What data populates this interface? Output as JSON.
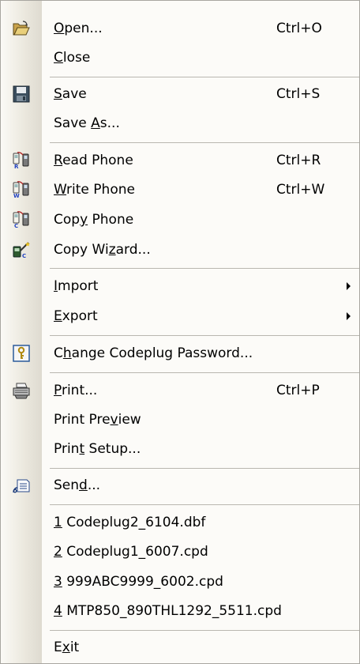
{
  "menu": {
    "open": {
      "pre": "",
      "ul": "O",
      "post": "pen...",
      "shortcut": "Ctrl+O"
    },
    "close": {
      "pre": "",
      "ul": "C",
      "post": "lose"
    },
    "save": {
      "pre": "",
      "ul": "S",
      "post": "ave",
      "shortcut": "Ctrl+S"
    },
    "save_as": {
      "pre": "Save ",
      "ul": "A",
      "post": "s..."
    },
    "read_phone": {
      "pre": "",
      "ul": "R",
      "post": "ead Phone",
      "shortcut": "Ctrl+R"
    },
    "write_phone": {
      "pre": "",
      "ul": "W",
      "post": "rite Phone",
      "shortcut": "Ctrl+W"
    },
    "copy_phone": {
      "pre": "Cop",
      "ul": "y",
      "post": " Phone"
    },
    "copy_wizard": {
      "pre": "Copy Wi",
      "ul": "z",
      "post": "ard..."
    },
    "import": {
      "pre": "",
      "ul": "I",
      "post": "mport"
    },
    "export": {
      "pre": "",
      "ul": "E",
      "post": "xport"
    },
    "change_password": {
      "pre": "C",
      "ul": "h",
      "post": "ange Codeplug Password..."
    },
    "print": {
      "pre": "",
      "ul": "P",
      "post": "rint...",
      "shortcut": "Ctrl+P"
    },
    "print_preview": {
      "pre": "Print Pre",
      "ul": "v",
      "post": "iew"
    },
    "print_setup": {
      "pre": "Prin",
      "ul": "t",
      "post": " Setup..."
    },
    "send": {
      "pre": "Sen",
      "ul": "d",
      "post": "..."
    },
    "recent1": {
      "pre": "",
      "ul": "1",
      "post": " Codeplug2_6104.dbf"
    },
    "recent2": {
      "pre": "",
      "ul": "2",
      "post": " Codeplug1_6007.cpd"
    },
    "recent3": {
      "pre": "",
      "ul": "3",
      "post": " 999ABC9999_6002.cpd"
    },
    "recent4": {
      "pre": "",
      "ul": "4",
      "post": " MTP850_890THL1292_5511.cpd"
    },
    "exit": {
      "pre": "E",
      "ul": "x",
      "post": "it"
    }
  },
  "icons": {
    "open": "open-folder-icon",
    "save": "floppy-disk-icon",
    "read_phone": "read-phone-icon",
    "write_phone": "write-phone-icon",
    "copy_phone": "copy-phone-icon",
    "copy_wizard": "copy-wizard-icon",
    "change_password": "key-password-icon",
    "print": "printer-icon",
    "send": "send-mail-icon"
  },
  "colors": {
    "menu_bg": "#fcfbf8",
    "gutter": "#e4e1d7",
    "separator": "#b9b7b0",
    "border": "#a8a6a0"
  }
}
